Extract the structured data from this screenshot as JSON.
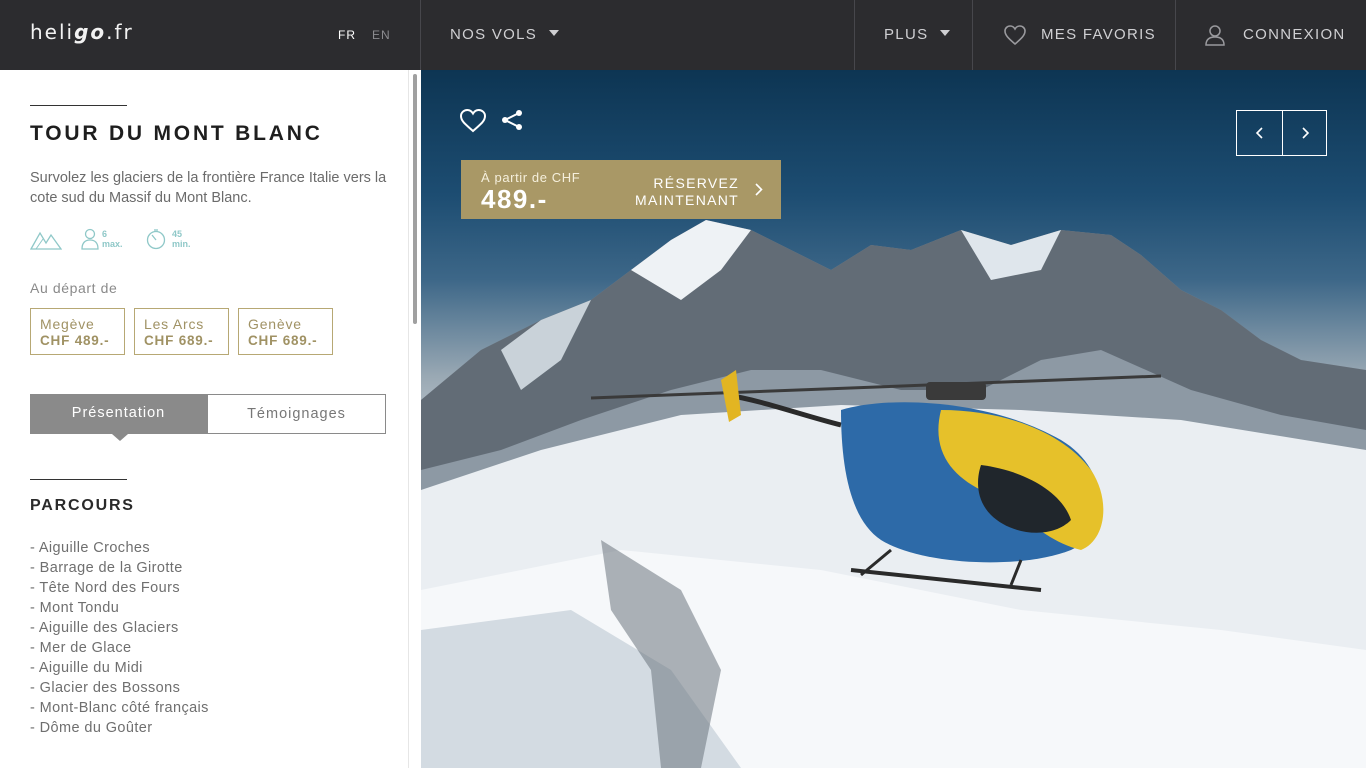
{
  "header": {
    "logo_a": "heli",
    "logo_b": "go",
    "logo_c": ".fr",
    "lang_fr": "FR",
    "lang_en": "EN",
    "nav_vols": "NOS VOLS",
    "nav_plus": "PLUS",
    "nav_favoris": "MES FAVORIS",
    "nav_connexion": "CONNEXION"
  },
  "tour": {
    "title": "TOUR DU MONT BLANC",
    "description": "Survolez les glaciers de la frontière France Italie vers la cote sud du Massif du Mont Blanc.",
    "info": {
      "terrain_icon": "mountains-icon",
      "passengers_value": "6",
      "passengers_unit": "max.",
      "duration_value": "45",
      "duration_unit": "min."
    },
    "departure_label": "Au départ de",
    "departures": [
      {
        "name": "Megève",
        "price": "CHF 489.-"
      },
      {
        "name": "Les Arcs",
        "price": "CHF 689.-"
      },
      {
        "name": "Genève",
        "price": "CHF 689.-"
      }
    ],
    "tabs": [
      "Présentation",
      "Témoignages"
    ],
    "section_title": "PARCOURS",
    "route": [
      "- Aiguille Croches",
      "- Barrage de la Girotte",
      "- Tête Nord des Fours",
      "- Mont Tondu",
      "- Aiguille des Glaciers",
      "- Mer de Glace",
      "- Aiguille du Midi",
      "- Glacier des Bossons",
      "- Mont-Blanc côté français",
      "- Dôme du Goûter"
    ]
  },
  "hero": {
    "booking_from": "À partir de CHF",
    "booking_price": "489.-",
    "booking_cta_line1": "RÉSERVEZ",
    "booking_cta_line2": "MAINTENANT"
  },
  "colors": {
    "nav_bg": "#2c2c2f",
    "gold": "#a99866",
    "tab_active": "#8a8a8a",
    "accent_teal": "#8fc8c8"
  }
}
